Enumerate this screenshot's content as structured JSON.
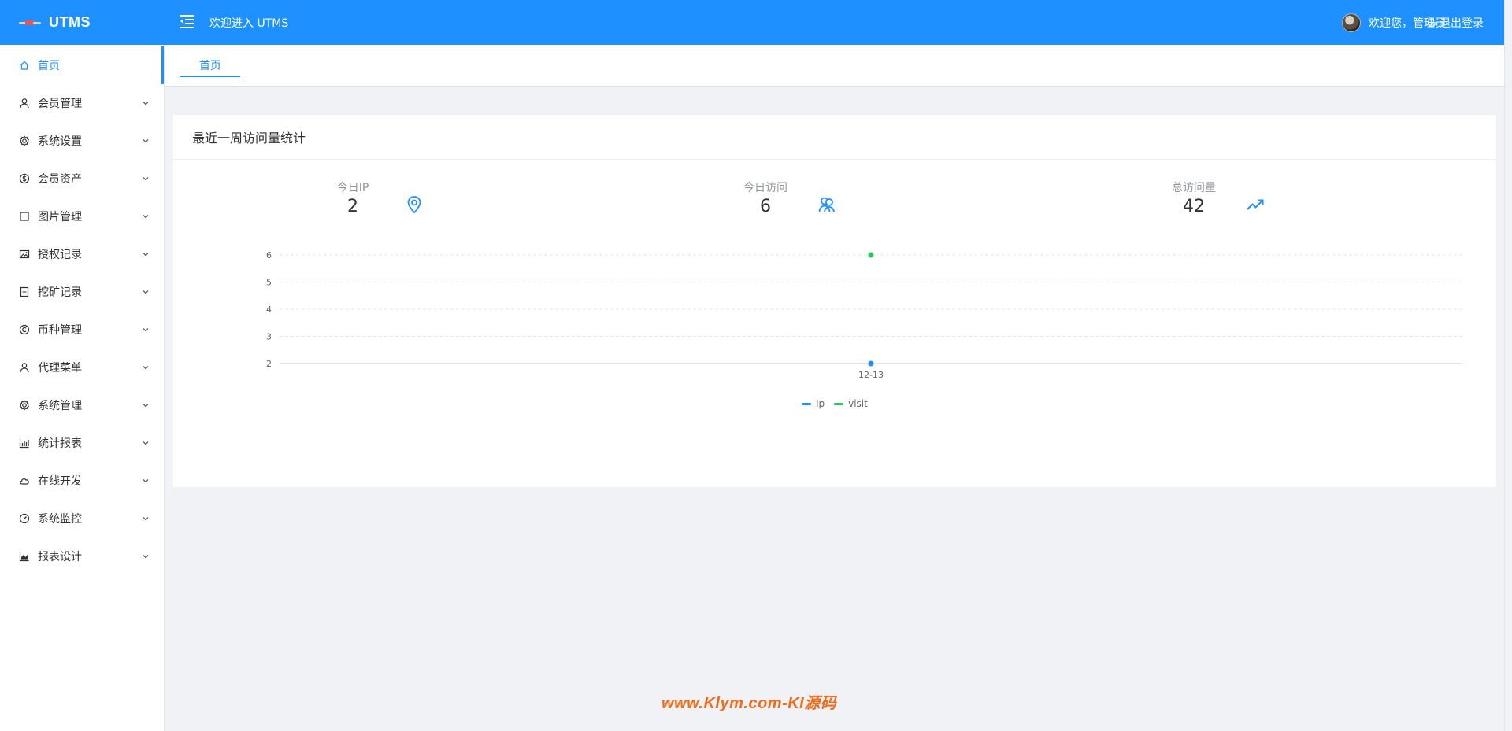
{
  "app": {
    "title": "UTMS",
    "welcome": "欢迎进入 UTMS"
  },
  "user": {
    "greeting": "欢迎您，管理员",
    "logout_label": "退出登录"
  },
  "colors": {
    "primary": "#1e90ff",
    "ip_series": "#1e90ff",
    "visit_series": "#2ec25b",
    "watermark": "#f06b1a"
  },
  "sidebar": {
    "items": [
      {
        "label": "首页",
        "icon": "home-icon"
      },
      {
        "label": "会员管理",
        "icon": "user-icon"
      },
      {
        "label": "系统设置",
        "icon": "gear-icon"
      },
      {
        "label": "会员资产",
        "icon": "dollar-icon"
      },
      {
        "label": "图片管理",
        "icon": "square-icon"
      },
      {
        "label": "授权记录",
        "icon": "picture-icon"
      },
      {
        "label": "挖矿记录",
        "icon": "document-icon"
      },
      {
        "label": "币种管理",
        "icon": "copyright-icon"
      },
      {
        "label": "代理菜单",
        "icon": "user-icon"
      },
      {
        "label": "系统管理",
        "icon": "gear-icon"
      },
      {
        "label": "统计报表",
        "icon": "bar-chart-icon"
      },
      {
        "label": "在线开发",
        "icon": "cloud-icon"
      },
      {
        "label": "系统监控",
        "icon": "gauge-icon"
      },
      {
        "label": "报表设计",
        "icon": "area-chart-icon"
      }
    ]
  },
  "tabs": [
    {
      "label": "首页"
    }
  ],
  "card": {
    "title": "最近一周访问量统计",
    "stats": [
      {
        "label": "今日IP",
        "value": "2",
        "icon": "location-icon"
      },
      {
        "label": "今日访问",
        "value": "6",
        "icon": "users-icon"
      },
      {
        "label": "总访问量",
        "value": "42",
        "icon": "trend-up-icon"
      }
    ]
  },
  "chart_data": {
    "type": "line",
    "categories": [
      "12-13"
    ],
    "series": [
      {
        "name": "ip",
        "values": [
          2
        ]
      },
      {
        "name": "visit",
        "values": [
          6
        ]
      }
    ],
    "yticks": [
      2,
      3,
      4,
      5,
      6
    ],
    "ylim": [
      2,
      6
    ],
    "grid": true,
    "legend_position": "bottom-center"
  },
  "watermark": "www.Klym.com-KI源码"
}
